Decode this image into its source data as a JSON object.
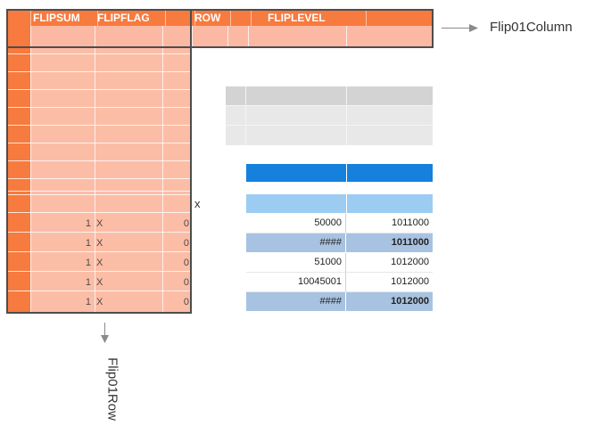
{
  "header": {
    "columns": [
      "FLIPSUM",
      "FLIPFLAG",
      "",
      "ROW",
      "",
      "FLIPLEVEL",
      ""
    ]
  },
  "flip_rows": [
    {
      "sum": "1",
      "flag": "X",
      "val": "0"
    },
    {
      "sum": "1",
      "flag": "X",
      "val": "0"
    },
    {
      "sum": "1",
      "flag": "X",
      "val": "0"
    },
    {
      "sum": "1",
      "flag": "X",
      "val": "0"
    },
    {
      "sum": "1",
      "flag": "X",
      "val": "0"
    }
  ],
  "marker": "x",
  "results": [
    {
      "a": "50000",
      "b": "1011000",
      "highlight": false
    },
    {
      "a": "####",
      "b": "1011000",
      "highlight": true
    },
    {
      "a": "51000",
      "b": "1012000",
      "highlight": false
    },
    {
      "a": "10045001",
      "b": "1012000",
      "highlight": false
    },
    {
      "a": "####",
      "b": "1012000",
      "highlight": true
    }
  ],
  "labels": {
    "column": "Flip01Column",
    "row": "Flip01Row"
  },
  "colors": {
    "orange": "#f77a3e",
    "salmon": "#fcbda7",
    "blue": "#1581dc",
    "light_blue": "#9cccf2",
    "highlight_blue": "#a8c3e1"
  }
}
